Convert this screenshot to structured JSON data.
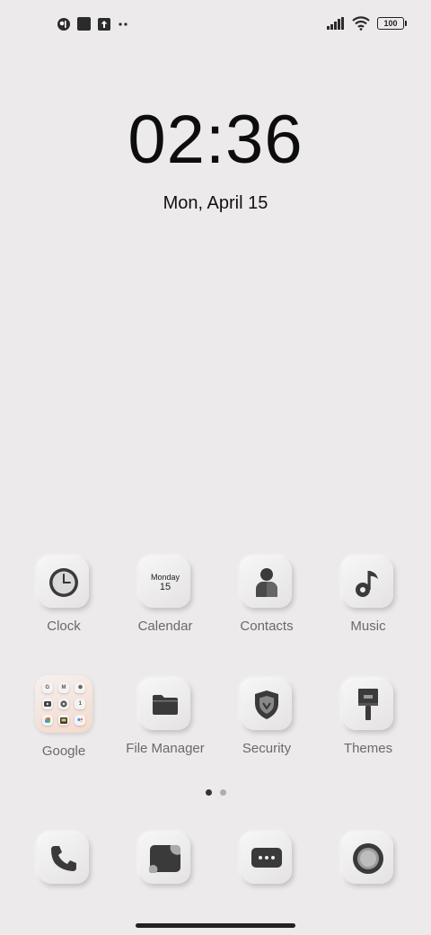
{
  "status_bar": {
    "left_icons": [
      "notification-icon",
      "square-notification-icon",
      "upload-notification-icon",
      "more-notifications-icon"
    ],
    "right_icons": [
      "signal-icon",
      "wifi-icon",
      "battery-icon"
    ],
    "battery_level": "100"
  },
  "clock": {
    "time": "02:36",
    "date": "Mon, April 15"
  },
  "calendar_icon": {
    "day": "Monday",
    "date_num": "15"
  },
  "apps_row1": [
    {
      "label": "Clock",
      "icon": "clock-icon"
    },
    {
      "label": "Calendar",
      "icon": "calendar-icon"
    },
    {
      "label": "Contacts",
      "icon": "contacts-icon"
    },
    {
      "label": "Music",
      "icon": "music-note-icon"
    }
  ],
  "apps_row2": [
    {
      "label": "Google",
      "icon": "google-folder-icon"
    },
    {
      "label": "File Manager",
      "icon": "folder-icon"
    },
    {
      "label": "Security",
      "icon": "shield-icon"
    },
    {
      "label": "Themes",
      "icon": "brush-icon"
    }
  ],
  "google_folder_minis": [
    "G",
    "M",
    "",
    "",
    "",
    "1",
    "",
    "",
    ""
  ],
  "page_indicator": {
    "pages": 2,
    "current": 1
  },
  "dock": [
    {
      "name": "phone",
      "icon": "phone-icon"
    },
    {
      "name": "gallery",
      "icon": "gallery-icon"
    },
    {
      "name": "messages",
      "icon": "message-icon"
    },
    {
      "name": "camera",
      "icon": "camera-icon"
    }
  ],
  "colors": {
    "background": "#ECEAEB",
    "icon_dark": "#3A3A3A",
    "label": "#6A6A6A"
  }
}
